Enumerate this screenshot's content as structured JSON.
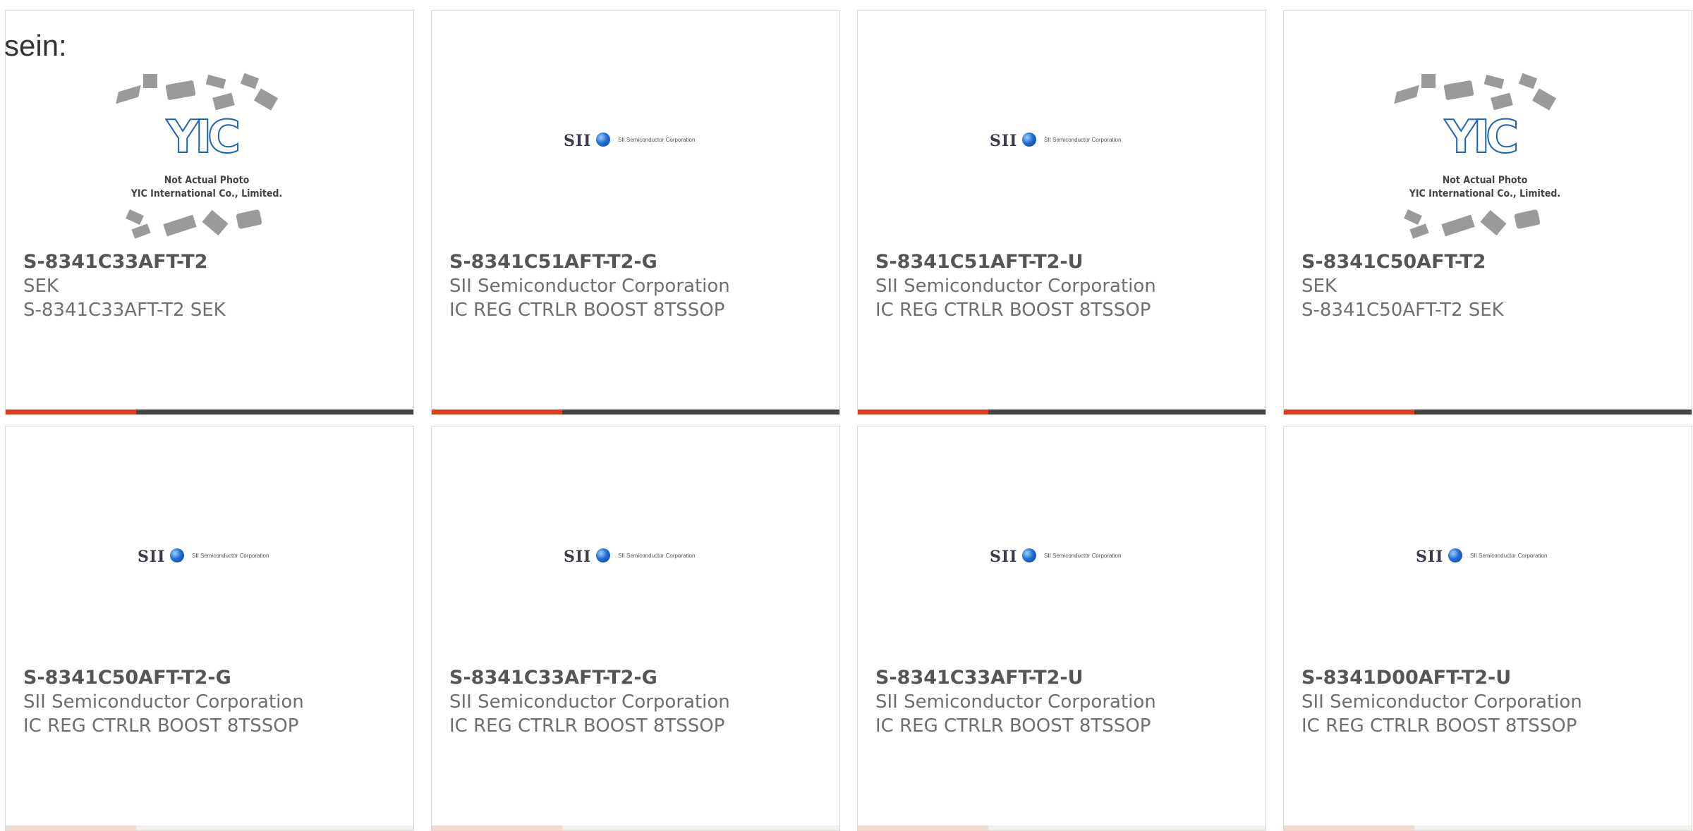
{
  "heading": "sein:",
  "accent_color": "#e03d17",
  "image_placeholder": {
    "caption_line1": "Not Actual Photo",
    "caption_line2": "YIC International Co., Limited.",
    "logo_text": "YIC"
  },
  "sii_logo": {
    "mark": "SII",
    "company": "SII Semiconductor Corporation"
  },
  "products": [
    {
      "part_number": "S-8341C33AFT-T2",
      "manufacturer": "SEK",
      "description": "S-8341C33AFT-T2 SEK",
      "image": "yic-placeholder",
      "progress": 0.32
    },
    {
      "part_number": "S-8341C51AFT-T2-G",
      "manufacturer": "SII Semiconductor Corporation",
      "description": "IC REG CTRLR BOOST 8TSSOP",
      "image": "sii-logo",
      "progress": 0.32
    },
    {
      "part_number": "S-8341C51AFT-T2-U",
      "manufacturer": "SII Semiconductor Corporation",
      "description": "IC REG CTRLR BOOST 8TSSOP",
      "image": "sii-logo",
      "progress": 0.32
    },
    {
      "part_number": "S-8341C50AFT-T2",
      "manufacturer": "SEK",
      "description": "S-8341C50AFT-T2 SEK",
      "image": "yic-placeholder",
      "progress": 0.32
    },
    {
      "part_number": "S-8341C50AFT-T2-G",
      "manufacturer": "SII Semiconductor Corporation",
      "description": "IC REG CTRLR BOOST 8TSSOP",
      "image": "sii-logo",
      "progress": 0.32
    },
    {
      "part_number": "S-8341C33AFT-T2-G",
      "manufacturer": "SII Semiconductor Corporation",
      "description": "IC REG CTRLR BOOST 8TSSOP",
      "image": "sii-logo",
      "progress": 0.32
    },
    {
      "part_number": "S-8341C33AFT-T2-U",
      "manufacturer": "SII Semiconductor Corporation",
      "description": "IC REG CTRLR BOOST 8TSSOP",
      "image": "sii-logo",
      "progress": 0.32
    },
    {
      "part_number": "S-8341D00AFT-T2-U",
      "manufacturer": "SII Semiconductor Corporation",
      "description": "IC REG CTRLR BOOST 8TSSOP",
      "image": "sii-logo",
      "progress": 0.32
    }
  ]
}
